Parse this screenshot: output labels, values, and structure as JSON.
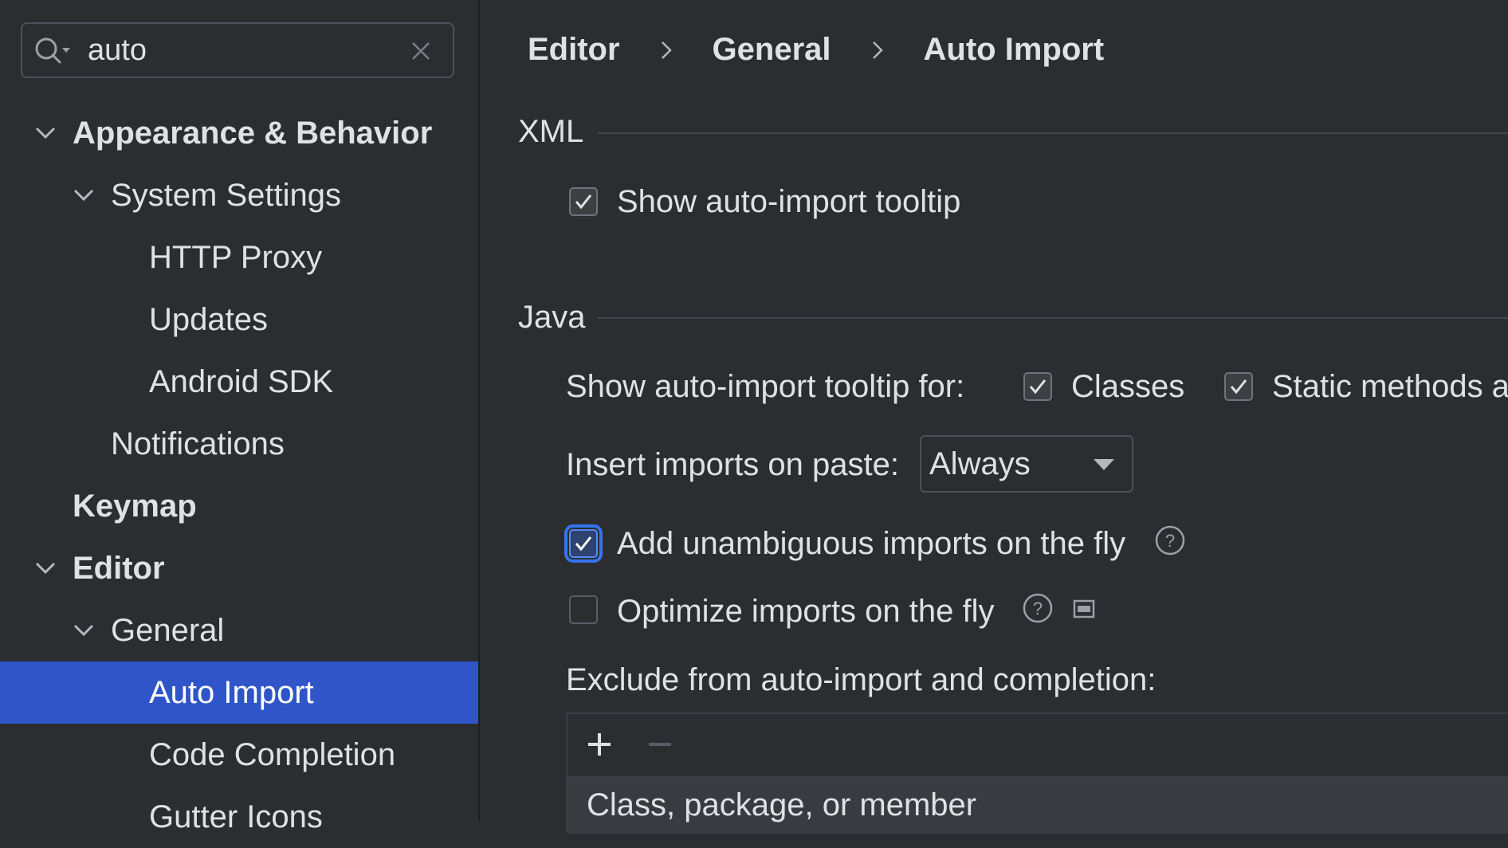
{
  "search": {
    "value": "auto"
  },
  "tree": {
    "appearance": "Appearance & Behavior",
    "system_settings": "System Settings",
    "http_proxy": "HTTP Proxy",
    "updates": "Updates",
    "android_sdk": "Android SDK",
    "notifications": "Notifications",
    "keymap": "Keymap",
    "editor": "Editor",
    "general": "General",
    "auto_import": "Auto Import",
    "code_completion": "Code Completion",
    "gutter_icons": "Gutter Icons"
  },
  "breadcrumb": [
    "Editor",
    "General",
    "Auto Import"
  ],
  "xml": {
    "title": "XML",
    "show_tooltip": {
      "label": "Show auto-import tooltip",
      "checked": true
    }
  },
  "java": {
    "title": "Java",
    "tooltip_for_label": "Show auto-import tooltip for:",
    "classes": {
      "label": "Classes",
      "checked": true
    },
    "static_methods": {
      "label": "Static methods a",
      "checked": true
    },
    "insert_on_paste_label": "Insert imports on paste:",
    "insert_on_paste_value": "Always",
    "add_unambiguous": {
      "label": "Add unambiguous imports on the fly",
      "checked": true
    },
    "optimize": {
      "label": "Optimize imports on the fly",
      "checked": false
    },
    "exclude_label": "Exclude from auto-import and completion:",
    "table_column": "Class, package, or member"
  },
  "colors": {
    "selection": "#2f55c8",
    "background": "#2b2d30",
    "accent": "#3574f0"
  }
}
